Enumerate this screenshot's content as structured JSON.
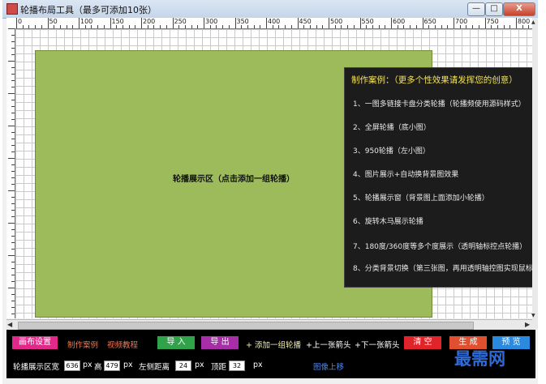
{
  "window": {
    "title": "轮播布局工具（最多可添加10张）",
    "min_label": "—",
    "max_label": "□",
    "close_label": "X"
  },
  "ruler": {
    "top_labels": [
      "0",
      "50",
      "100",
      "150",
      "200",
      "250",
      "300",
      "350",
      "400",
      "450",
      "500",
      "550",
      "600",
      "650",
      "700",
      "750",
      "800"
    ]
  },
  "canvas": {
    "slide_area_label": "轮播展示区（点击添加一组轮播）",
    "slide_area_color": "#9dbb5a"
  },
  "examples": {
    "title": "制作案例：（更多个性效果请发挥您的创意）",
    "items": [
      "1、一图多链接卡盘分类轮播（轮播频使用源码样式）",
      "2、全屏轮播（底小图）",
      "3、950轮播（左小图）",
      "4、图片展示+自动换背景图效果",
      "5、轮播展示窗（背景图上面添加小轮播）",
      "6、旋转木马展示轮播",
      "7、180度/360度等多个度展示（透明轴标控点轮播）",
      "8、分类背景切换（第三张图，再用透明轴控图实现鼠标"
    ]
  },
  "toolbar": {
    "canvas_settings": "画布设置",
    "make_examples": "制作案例",
    "video_tutorial": "视频教程",
    "import": "导 入",
    "export": "导 出",
    "add_group": "+ 添加一组轮播",
    "prev_arrow": "+上一张箭头",
    "next_arrow": "+下一张箭头",
    "clear": "清 空",
    "generate": "生 成",
    "preview": "预 览",
    "area_width_label": "轮播展示区宽",
    "area_width_value": "636",
    "px1": "px",
    "height_label": "高",
    "area_height_value": "479",
    "px2": "px",
    "left_distance_label": "左侧距离",
    "left_distance_value": "24",
    "px3": "px",
    "top_distance_label": "顶距",
    "top_distance_value": "32",
    "px4": "px",
    "image_up": "图像上移"
  },
  "watermark": "最需网",
  "colors": {
    "canvas_settings_btn": "#e0298a",
    "import_btn": "#2fa24a",
    "export_btn": "#a82ea8",
    "clear_btn": "#e0242a",
    "generate_btn": "#e05030",
    "preview_btn": "#2a8ae0",
    "examples_title": "#f3e25a"
  }
}
